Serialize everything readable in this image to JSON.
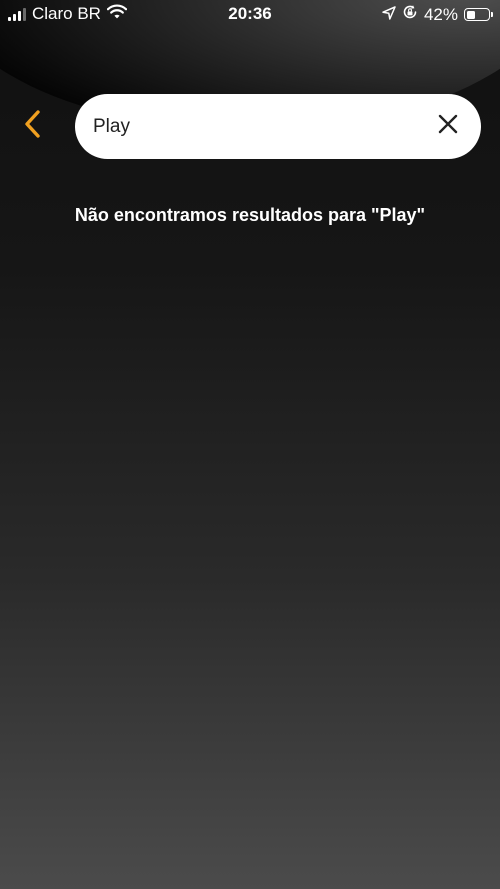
{
  "status_bar": {
    "carrier": "Claro BR",
    "time": "20:36",
    "battery_percent_label": "42%",
    "battery_level": 0.42,
    "icons": [
      "signal-icon",
      "wifi-icon",
      "location-arrow-icon",
      "orientation-lock-icon",
      "battery-icon"
    ]
  },
  "header": {
    "back_icon": "chevron-left-icon",
    "search": {
      "value": "Play",
      "clear_icon": "close-icon"
    }
  },
  "results": {
    "empty_message": "Não encontramos resultados para \"Play\""
  },
  "colors": {
    "accent": "#f0a020",
    "search_background": "#ffffff",
    "text_primary": "#ffffff"
  }
}
